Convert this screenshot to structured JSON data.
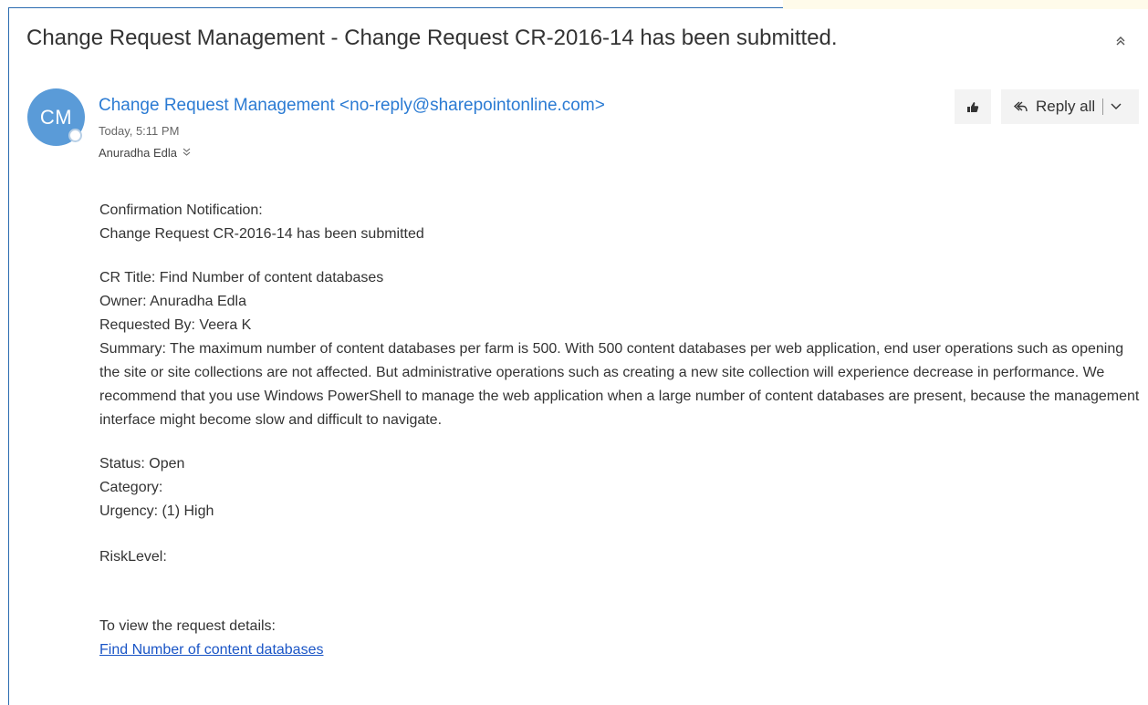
{
  "message": {
    "subject": "Change Request Management - Change Request CR-2016-14 has been submitted.",
    "avatar_initials": "CM",
    "sender": "Change Request Management <no-reply@sharepointonline.com>",
    "sent_time": "Today, 5:11 PM",
    "recipient": "Anuradha Edla",
    "avatar_color": "#5a9bd8",
    "sender_color": "#2b7bd3"
  },
  "actions": {
    "like_icon": "like-icon",
    "reply_all_label": "Reply all"
  },
  "body": {
    "line_1": "Confirmation Notification:",
    "line_2": "Change Request CR-2016-14 has been submitted",
    "cr_title": "CR Title: Find Number of content databases",
    "owner": "Owner: Anuradha Edla",
    "requested_by": "Requested By: Veera K",
    "summary": "Summary: The maximum number of content databases per farm is 500. With 500 content databases per web application, end user operations such as opening the site or site collections are not affected. But administrative operations such as creating a new site collection will experience decrease in performance. We recommend that you use Windows PowerShell to manage the web application when a large number of content databases are present, because the management interface might become slow and difficult to navigate.",
    "status": "Status: Open",
    "category": "Category:",
    "urgency": "Urgency: (1) High",
    "risk_level": "RiskLevel:",
    "view_details": "To view the request details:",
    "link_text": "Find Number of content databases",
    "link_color": "#1a55c6"
  }
}
